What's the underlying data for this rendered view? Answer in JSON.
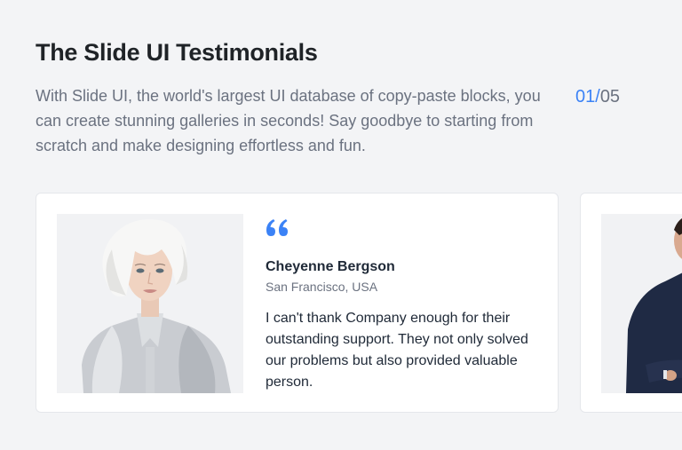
{
  "header": {
    "title": "The Slide UI Testimonials",
    "description": "With Slide UI, the world's largest UI database of copy-paste blocks, you can create stunning galleries in seconds! Say goodbye to starting from scratch and make designing effortless and fun."
  },
  "pagination": {
    "current": "01",
    "separator": "/",
    "total": "05"
  },
  "testimonials": [
    {
      "name": "Cheyenne Bergson",
      "location": "San Francisco, USA",
      "quote": "I can't thank Company enough for their outstanding support. They not only solved our problems but also provided valuable person."
    }
  ],
  "colors": {
    "accent": "#3b82f6",
    "background": "#f3f4f6",
    "card": "#ffffff"
  },
  "icons": {
    "quote": "quote-icon"
  }
}
